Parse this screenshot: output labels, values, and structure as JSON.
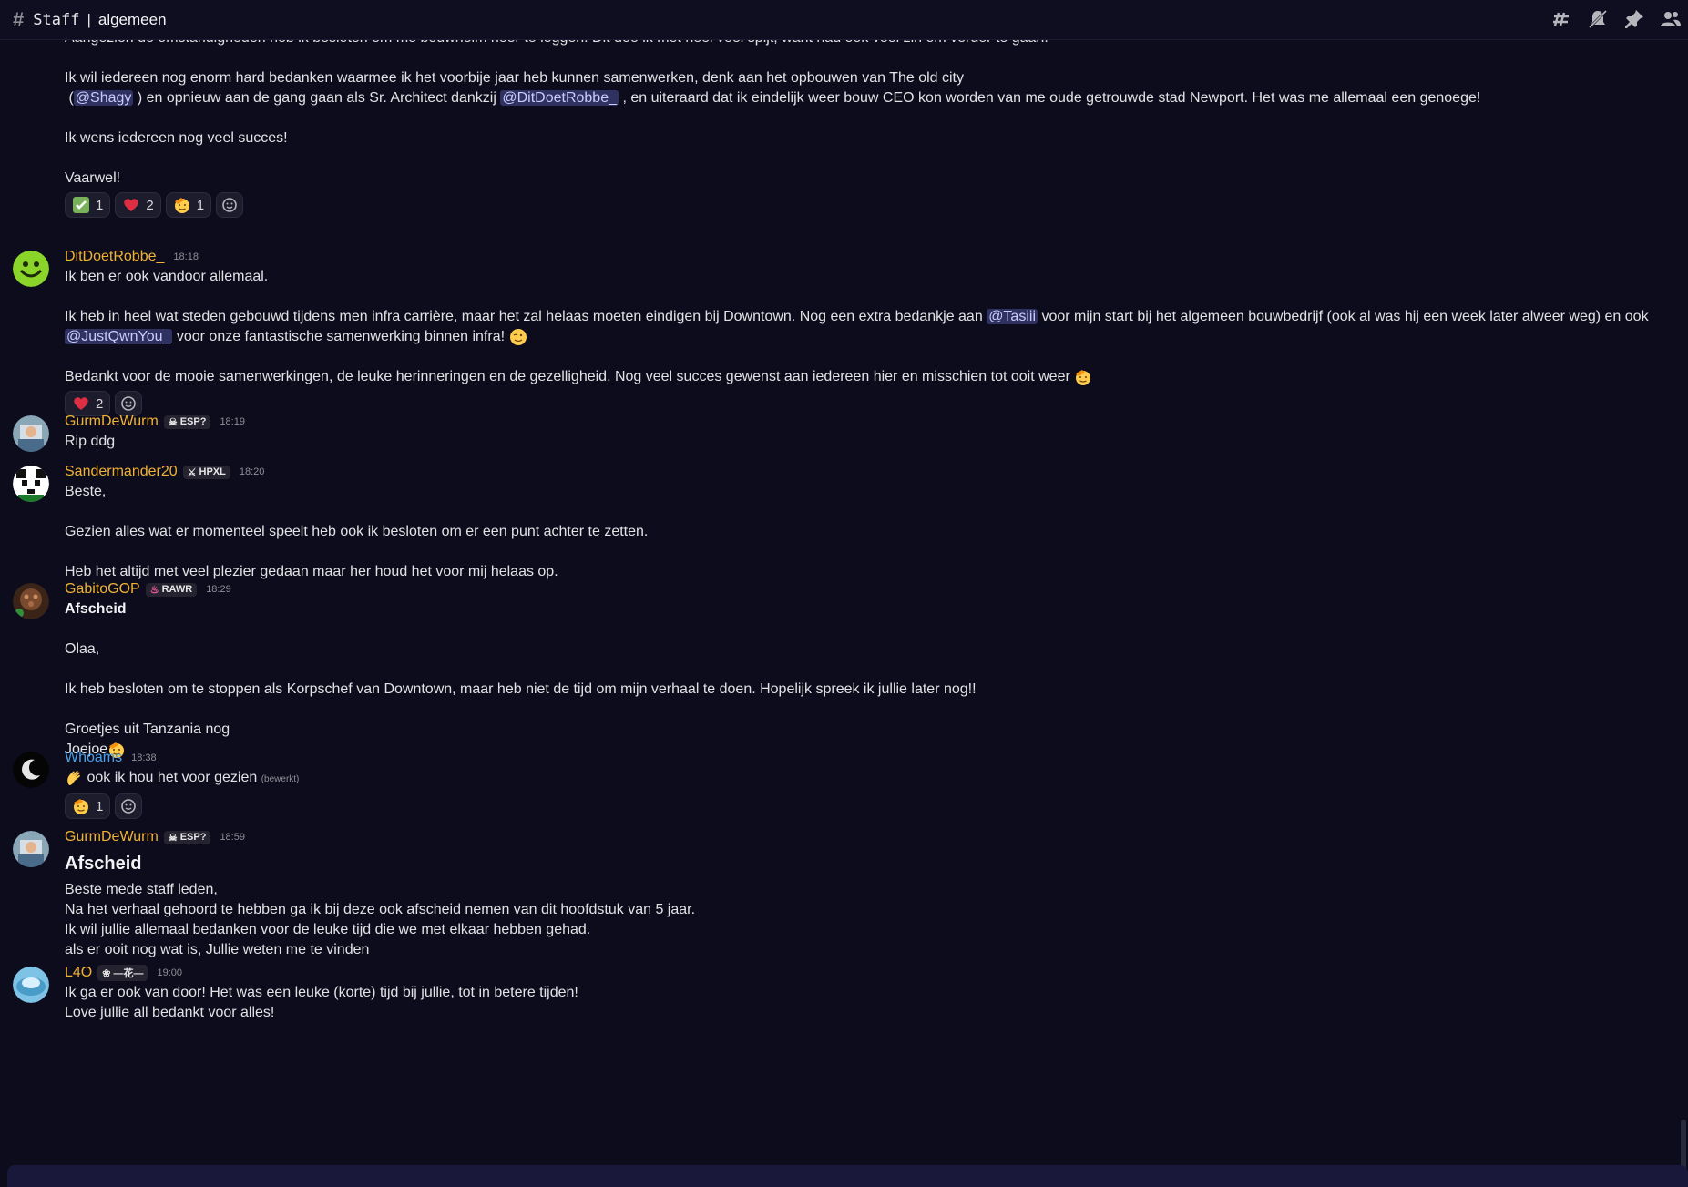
{
  "channel": {
    "prefix": "Staff",
    "separator": "|",
    "name": "algemeen",
    "icons": [
      "threads-icon",
      "mute-icon",
      "pin-icon",
      "members-icon"
    ]
  },
  "messages": {
    "m0": {
      "l1": "Aangezien de omstandigheden heb ik besloten om me bouwhelm neer te leggen. Dit doe ik met heel veel spijt, want had ook veel zin om verder te gaan.",
      "l2": "Ik wil iedereen nog enorm hard bedanken waarmee ik het voorbije jaar heb kunnen samenwerken, denk aan het opbouwen van The old city",
      "l3a": "(",
      "l3_mention1": "@Shagy",
      "l3b": ") en opnieuw aan de gang gaan als Sr. Architect dankzij",
      "l3_mention2": "@DitDoetRobbe_",
      "l3c": ", en uiteraard dat ik eindelijk weer bouw CEO kon worden van me oude getrouwde stad Newport. Het was me allemaal een genoege!",
      "l4": "Ik wens iedereen nog veel succes!",
      "l5": "Vaarwel!",
      "reactions": [
        {
          "emoji": "check-emoji",
          "count": "1"
        },
        {
          "emoji": "heart-emoji",
          "count": "2"
        },
        {
          "emoji": "salute-emoji",
          "count": "1"
        }
      ]
    },
    "m1": {
      "user": "DitDoetRobbe_",
      "time": "18:18",
      "l1": "Ik ben er ook vandoor allemaal.",
      "l2a": "Ik heb in heel wat steden gebouwd tijdens men infra carrière, maar het zal helaas moeten eindigen bij Downtown. Nog een extra bedankje aan",
      "l2_mention": "@Tasiii",
      "l2b": "voor mijn start bij het algemeen bouwbedrijf (ook al was hij een week later alweer weg) en ook",
      "l3_mention": "@JustQwnYou_",
      "l3b": "voor onze fantastische samenwerking binnen infra!",
      "l4": "Bedankt voor de mooie samenwerkingen, de leuke herinneringen en de gezelligheid. Nog veel succes gewenst aan iedereen hier en misschien tot ooit weer",
      "reactions": [
        {
          "emoji": "heart-emoji",
          "count": "2"
        }
      ]
    },
    "m2": {
      "user": "GurmDeWurm",
      "tag": "ESP?",
      "time": "18:19",
      "l1": "Rip ddg"
    },
    "m3": {
      "user": "Sandermander20",
      "tag": "HPXL",
      "time": "18:20",
      "l1": "Beste,",
      "l2": "Gezien alles wat er momenteel speelt heb ook ik besloten om er een punt achter te zetten.",
      "l3": "Heb het altijd met veel plezier gedaan maar her houd het voor mij helaas op."
    },
    "m4": {
      "user": "GabitoGOP",
      "tag": "RAWR",
      "time": "18:29",
      "l1": "Afscheid",
      "l2": "Olaa,",
      "l3": "Ik heb besloten om te stoppen als Korpschef van Downtown, maar heb niet de tijd om mijn verhaal te doen. Hopelijk spreek ik jullie later nog!!",
      "l4": "Groetjes uit Tanzania nog",
      "l5": "Joejoe"
    },
    "m5": {
      "user": "Whoams",
      "time": "18:38",
      "l1": "ook ik hou het voor gezien",
      "edited": "(bewerkt)",
      "reactions": [
        {
          "emoji": "salute-emoji",
          "count": "1"
        }
      ]
    },
    "m6": {
      "user": "GurmDeWurm",
      "tag": "ESP?",
      "time": "18:59",
      "heading": "Afscheid",
      "l1": "Beste mede staff leden,",
      "l2": "Na het verhaal gehoord te hebben ga ik bij deze ook afscheid nemen van dit hoofdstuk van 5 jaar.",
      "l3": "Ik wil jullie allemaal bedanken voor de leuke tijd die we met elkaar hebben gehad.",
      "l4": "als er ooit nog wat is, Jullie weten me te vinden"
    },
    "m7": {
      "user": "L4O",
      "tag": "—花—",
      "time": "19:00",
      "l1": "Ik ga er ook van door! Het was een leuke (korte) tijd bij jullie, tot in betere tijden!",
      "l2": "Love jullie all bedankt voor alles!"
    }
  },
  "colors": {
    "background": "#0d0c1d",
    "username": "#f0b232",
    "username_alt": "#4aa0e8",
    "mention_bg": "#2f3160"
  }
}
